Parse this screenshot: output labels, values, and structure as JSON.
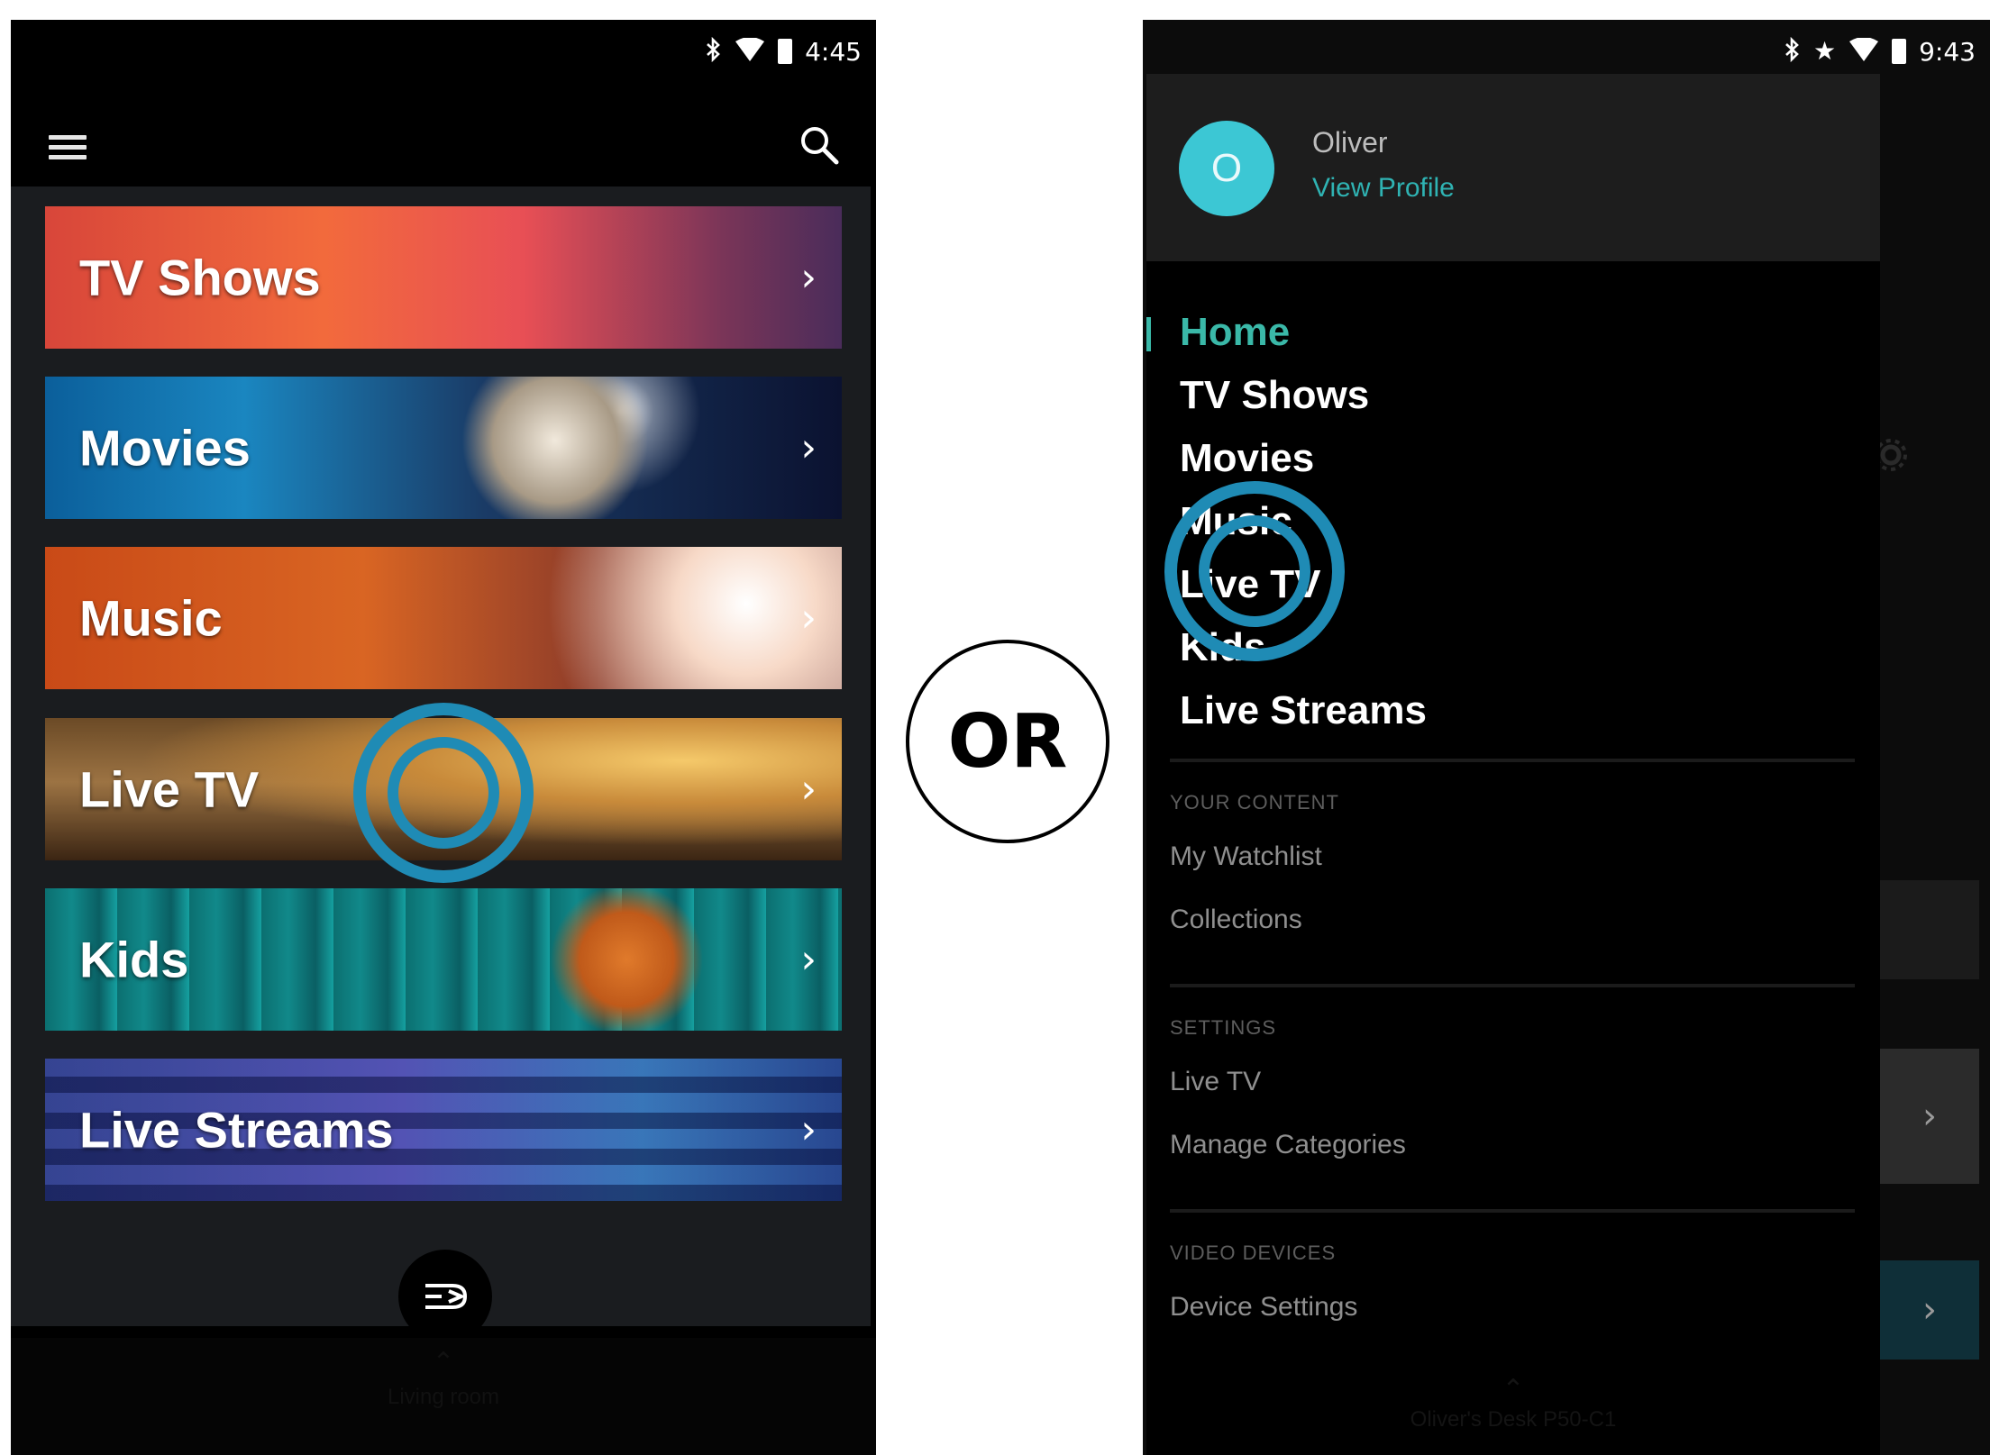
{
  "left_phone": {
    "status_bar": {
      "time": "4:45",
      "icons": [
        "bluetooth-icon",
        "wifi-icon",
        "battery-icon"
      ]
    },
    "app_bar": {
      "menu_icon": "hamburger-menu-icon",
      "search_icon": "search-icon"
    },
    "tiles": [
      {
        "label": "TV Shows",
        "chevron": "›"
      },
      {
        "label": "Movies",
        "chevron": "›"
      },
      {
        "label": "Music",
        "chevron": "›"
      },
      {
        "label": "Live TV",
        "chevron": "›"
      },
      {
        "label": "Kids",
        "chevron": "›"
      },
      {
        "label": "Live Streams",
        "chevron": "›"
      }
    ],
    "fab_icon": "remote-switch-icon",
    "bottom_bar": {
      "line1": "Living room",
      "line2": ""
    }
  },
  "or_label": "OR",
  "right_phone": {
    "status_bar": {
      "time": "9:43",
      "icons": [
        "bluetooth-icon",
        "star-icon",
        "wifi-icon",
        "battery-icon"
      ]
    },
    "profile": {
      "initial": "O",
      "name": "Oliver",
      "link": "View Profile"
    },
    "nav_items": [
      "Home",
      "TV Shows",
      "Movies",
      "Music",
      "Live TV",
      "Kids",
      "Live Streams"
    ],
    "active_item": "Home",
    "sections": [
      {
        "header": "YOUR CONTENT",
        "items": [
          "My Watchlist",
          "Collections"
        ]
      },
      {
        "header": "SETTINGS",
        "items": [
          "Live TV",
          "Manage Categories"
        ]
      },
      {
        "header": "VIDEO DEVICES",
        "items": [
          "Device Settings"
        ]
      }
    ],
    "bottom_bar": {
      "line1": "Oliver's Desk P50-C1"
    },
    "side_chevron": "›"
  },
  "colors": {
    "accent_teal": "#3ab8a8",
    "avatar_cyan": "#3cc7d4",
    "tap_ring_blue": "#1f8bb5",
    "background": "#000000"
  }
}
